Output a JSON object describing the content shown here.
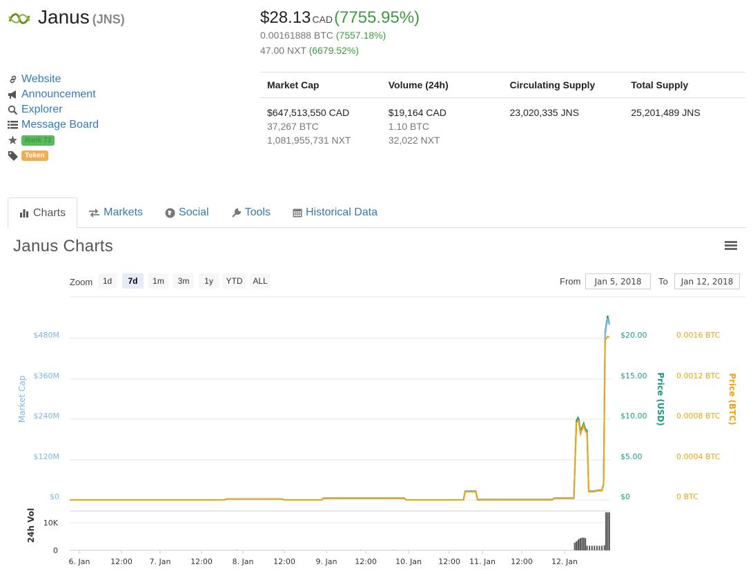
{
  "coin": {
    "name": "Janus",
    "symbol": "(JNS)"
  },
  "price": {
    "main_value": "$28.13",
    "main_currency": "CAD",
    "main_change": "(7755.95%)",
    "btc_value": "0.00161888 BTC",
    "btc_change": "(7557.18%)",
    "nxt_value": "47.00 NXT",
    "nxt_change": "(6679.52%)"
  },
  "links": {
    "website": "Website",
    "announcement": "Announcement",
    "explorer": "Explorer",
    "message_board": "Message Board",
    "rank_badge": "Rank 73",
    "token_badge": "Token"
  },
  "stats": {
    "headers": [
      "Market Cap",
      "Volume (24h)",
      "Circulating Supply",
      "Total Supply"
    ],
    "market_cap": [
      "$647,513,550 CAD",
      "37,267 BTC",
      "1,081,955,731 NXT"
    ],
    "volume": [
      "$19,164 CAD",
      "1.10 BTC",
      "32,022 NXT"
    ],
    "circulating": "23,020,335 JNS",
    "total": "25,201,489 JNS"
  },
  "tabs": [
    "Charts",
    "Markets",
    "Social",
    "Tools",
    "Historical Data"
  ],
  "chart_title": "Janus Charts",
  "range_selector": {
    "zoom_label": "Zoom",
    "buttons": [
      "1d",
      "7d",
      "1m",
      "3m",
      "1y",
      "YTD",
      "ALL"
    ],
    "selected": "7d",
    "from_label": "From",
    "from_value": "Jan 5, 2018",
    "to_label": "To",
    "to_value": "Jan 12, 2018"
  },
  "colors": {
    "market_cap": "#7cb5ec",
    "price_usd": "#1a9a85",
    "price_btc": "#f0a30a",
    "link": "#337ab7",
    "positive": "#3c9b3c"
  },
  "chart_data": {
    "type": "line",
    "x_ticks": [
      "6. Jan",
      "12:00",
      "7. Jan",
      "12:00",
      "8. Jan",
      "12:00",
      "9. Jan",
      "12:00",
      "10. Jan",
      "12:00",
      "11. Jan",
      "12:00",
      "12. Jan"
    ],
    "axes": {
      "market_cap": {
        "label": "Market Cap",
        "ticks": [
          "$0",
          "$120M",
          "$240M",
          "$360M",
          "$480M"
        ],
        "range": [
          0,
          480
        ]
      },
      "price_usd": {
        "label": "Price (USD)",
        "ticks": [
          "$0",
          "$5.00",
          "$10.00",
          "$15.00",
          "$20.00"
        ],
        "range": [
          0,
          20
        ]
      },
      "price_btc": {
        "label": "Price (BTC)",
        "ticks": [
          "0 BTC",
          "0.0004 BTC",
          "0.0008 BTC",
          "0.0012 BTC",
          "0.0016 BTC"
        ],
        "range": [
          0,
          0.0016
        ]
      },
      "volume": {
        "label": "24h Vol",
        "ticks": [
          "0",
          "10K"
        ]
      }
    },
    "x_range_days": [
      5.92,
      12.48
    ],
    "series": [
      {
        "key": "price_usd",
        "points": [
          [
            5.92,
            0
          ],
          [
            7.8,
            0
          ],
          [
            7.82,
            0.12
          ],
          [
            8.5,
            0.12
          ],
          [
            8.52,
            0
          ],
          [
            8.98,
            0
          ],
          [
            9.0,
            0.2
          ],
          [
            9.98,
            0.2
          ],
          [
            10.0,
            0
          ],
          [
            10.7,
            0
          ],
          [
            10.72,
            1.1
          ],
          [
            10.85,
            1.1
          ],
          [
            10.87,
            0.05
          ],
          [
            11.78,
            0.05
          ],
          [
            11.8,
            0.2
          ],
          [
            11.95,
            0.2
          ],
          [
            12.04,
            0.2
          ],
          [
            12.07,
            9.8
          ],
          [
            12.09,
            10.2
          ],
          [
            12.1,
            10.0
          ],
          [
            12.12,
            8.5
          ],
          [
            12.14,
            9.0
          ],
          [
            12.16,
            9.5
          ],
          [
            12.18,
            8.8
          ],
          [
            12.2,
            8.6
          ],
          [
            12.22,
            1.1
          ],
          [
            12.28,
            1.1
          ],
          [
            12.33,
            1.2
          ],
          [
            12.38,
            1.2
          ],
          [
            12.4,
            2.0
          ],
          [
            12.42,
            20.8
          ],
          [
            12.45,
            22.8
          ],
          [
            12.47,
            21.8
          ]
        ]
      },
      {
        "key": "market_cap",
        "points": [
          [
            5.92,
            0
          ],
          [
            7.8,
            0
          ],
          [
            7.82,
            2.9
          ],
          [
            8.5,
            2.9
          ],
          [
            8.52,
            0
          ],
          [
            8.98,
            0
          ],
          [
            9.0,
            4.8
          ],
          [
            9.98,
            4.8
          ],
          [
            10.0,
            0
          ],
          [
            10.7,
            0
          ],
          [
            10.72,
            26
          ],
          [
            10.85,
            26
          ],
          [
            10.87,
            1.2
          ],
          [
            11.78,
            1.2
          ],
          [
            11.8,
            4.8
          ],
          [
            11.95,
            4.8
          ],
          [
            12.04,
            4.8
          ],
          [
            12.07,
            228
          ],
          [
            12.09,
            236
          ],
          [
            12.1,
            232
          ],
          [
            12.12,
            196
          ],
          [
            12.14,
            208
          ],
          [
            12.16,
            220
          ],
          [
            12.18,
            204
          ],
          [
            12.2,
            200
          ],
          [
            12.22,
            26
          ],
          [
            12.28,
            26
          ],
          [
            12.33,
            28
          ],
          [
            12.38,
            28
          ],
          [
            12.4,
            46
          ],
          [
            12.42,
            492
          ],
          [
            12.45,
            540
          ],
          [
            12.47,
            520
          ]
        ]
      },
      {
        "key": "price_btc",
        "points": [
          [
            5.92,
            0
          ],
          [
            7.8,
            0
          ],
          [
            7.82,
            1e-05
          ],
          [
            8.5,
            1e-05
          ],
          [
            8.52,
            0
          ],
          [
            8.98,
            0
          ],
          [
            9.0,
            2e-05
          ],
          [
            9.98,
            2e-05
          ],
          [
            10.0,
            0
          ],
          [
            10.7,
            0
          ],
          [
            10.72,
            8e-05
          ],
          [
            10.85,
            8e-05
          ],
          [
            10.87,
            0
          ],
          [
            11.78,
            0
          ],
          [
            11.8,
            2e-05
          ],
          [
            11.95,
            2e-05
          ],
          [
            12.04,
            2e-05
          ],
          [
            12.07,
            0.00076
          ],
          [
            12.09,
            0.00079
          ],
          [
            12.1,
            0.00077
          ],
          [
            12.12,
            0.00066
          ],
          [
            12.14,
            0.0007
          ],
          [
            12.16,
            0.00074
          ],
          [
            12.18,
            0.00068
          ],
          [
            12.2,
            0.00066
          ],
          [
            12.22,
            8e-05
          ],
          [
            12.28,
            8e-05
          ],
          [
            12.33,
            9e-05
          ],
          [
            12.38,
            9e-05
          ],
          [
            12.4,
            0.00015
          ],
          [
            12.42,
            0.00158
          ],
          [
            12.45,
            0.00162
          ],
          [
            12.47,
            0.00161
          ]
        ]
      },
      {
        "key": "volume",
        "points": [
          [
            7.95,
            0.12
          ],
          [
            8.5,
            0.12
          ],
          [
            9.45,
            0.12
          ],
          [
            9.85,
            0.12
          ],
          [
            12.05,
            3.0
          ],
          [
            12.07,
            3.5
          ],
          [
            12.09,
            4.0
          ],
          [
            12.1,
            4.5
          ],
          [
            12.12,
            4.8
          ],
          [
            12.14,
            5.0
          ],
          [
            12.16,
            5.0
          ],
          [
            12.18,
            4.8
          ],
          [
            12.2,
            1.8
          ],
          [
            12.23,
            1.8
          ],
          [
            12.26,
            1.8
          ],
          [
            12.29,
            1.8
          ],
          [
            12.32,
            1.8
          ],
          [
            12.35,
            1.8
          ],
          [
            12.38,
            1.8
          ],
          [
            12.41,
            2.0
          ],
          [
            12.43,
            15.0
          ],
          [
            12.45,
            15.0
          ],
          [
            12.47,
            15.0
          ]
        ]
      }
    ]
  }
}
